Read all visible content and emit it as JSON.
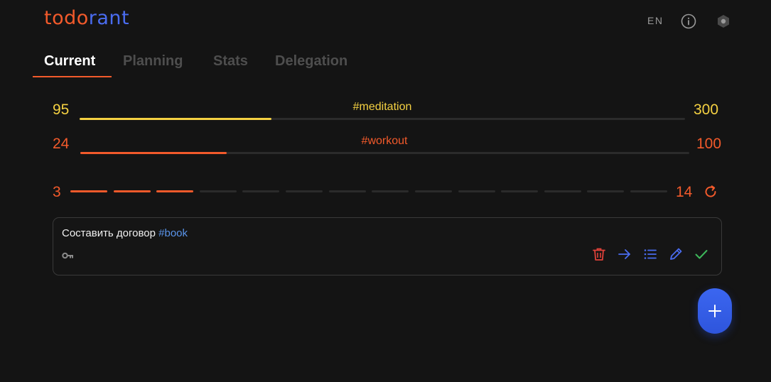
{
  "app": {
    "logo_part1": "todo",
    "logo_part2": "rant"
  },
  "header": {
    "language": "EN",
    "icons": [
      "info-icon",
      "settings-hex-icon"
    ]
  },
  "tabs": [
    {
      "label": "Current",
      "active": true
    },
    {
      "label": "Planning",
      "active": false
    },
    {
      "label": "Stats",
      "active": false
    },
    {
      "label": "Delegation",
      "active": false
    }
  ],
  "progress": [
    {
      "tag": "#meditation",
      "current": "95",
      "goal": "300",
      "fraction": 0.3167,
      "color": "#f5d142"
    },
    {
      "tag": "#workout",
      "current": "24",
      "goal": "100",
      "fraction": 0.24,
      "color": "#f25a2b"
    }
  ],
  "epics": {
    "done": "3",
    "total": "14",
    "icon": "refresh-icon"
  },
  "todo": {
    "text": "Составить договор ",
    "hashtag": "#book",
    "icons": [
      "key-icon"
    ],
    "actions": [
      "trash-icon",
      "arrow-right-icon",
      "list-icon",
      "pencil-icon",
      "check-icon"
    ]
  },
  "fab": {
    "icon": "plus-icon"
  },
  "colors": {
    "background": "#141414",
    "accent_orange": "#f25a2b",
    "accent_blue": "#4a6cf0",
    "meditation_yellow": "#f5d142",
    "done_green": "#3db85a",
    "delete_red": "#e0413a"
  }
}
